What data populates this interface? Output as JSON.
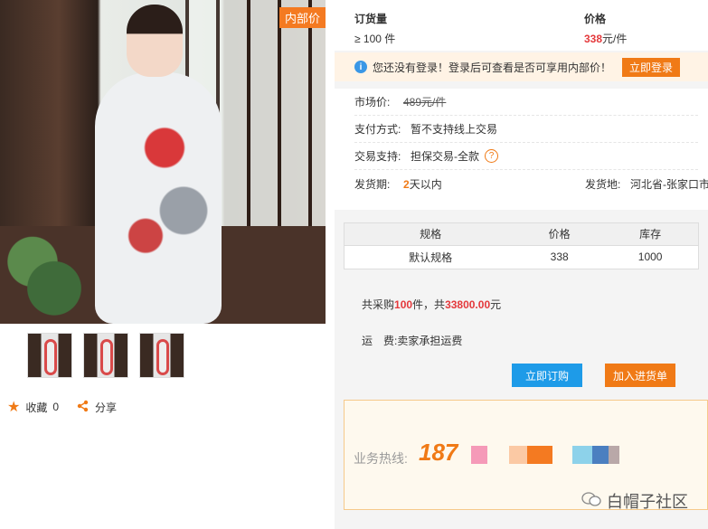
{
  "left": {
    "badge": "内部价",
    "actions": {
      "favorite_label": "收藏",
      "favorite_count": "0",
      "share_label": "分享"
    }
  },
  "order": {
    "qty_label": "订货量",
    "price_label": "价格",
    "qty_value": "≥ 100",
    "qty_unit": "件",
    "price_value": "338",
    "price_unit": "元/件"
  },
  "notice": {
    "text": "您还没有登录！登录后可查看是否可享用内部价！",
    "button": "立即登录"
  },
  "props": {
    "market_label": "市场价:",
    "market_value": "489元/件",
    "pay_label": "支付方式:",
    "pay_value": "暂不支持线上交易",
    "trade_label": "交易支持:",
    "trade_value": "担保交易-全款",
    "ship_label": "发货期:",
    "ship_num": "2",
    "ship_rest": "天以内",
    "origin_label": "发货地:",
    "origin_value": "河北省-张家口市"
  },
  "spec": {
    "headers": [
      "规格",
      "价格",
      "库存"
    ],
    "row": [
      "默认规格",
      "338",
      "1000"
    ]
  },
  "totals": {
    "t1_a": "共采购",
    "t1_qty": "100",
    "t1_b": "件，共",
    "t1_amount": "33800.00",
    "t1_c": "元",
    "ship_label": "运　费:",
    "ship_value": "卖家承担运费"
  },
  "buttons": {
    "buy": "立即订购",
    "cart": "加入进货单"
  },
  "hotline": {
    "label": "业务热线:",
    "number": "187"
  },
  "watermark": "白帽子社区"
}
